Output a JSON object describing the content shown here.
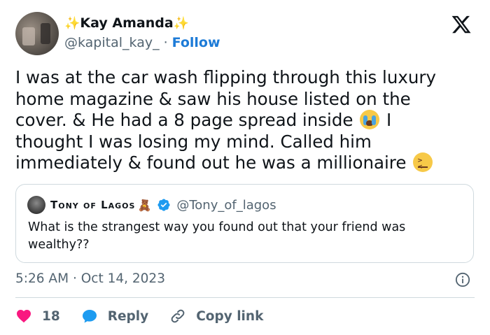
{
  "author": {
    "name": "Kay Amanda",
    "handle": "@kapital_kay_",
    "separator": "·",
    "follow_label": "Follow"
  },
  "tweet": {
    "text_part1": "I was at the car wash flipping through this luxury home magazine & saw his house listed on the cover. & He had a 8 page spread inside",
    "text_part2": "I thought I was losing my mind. Called him immediately & found out he was a millionaire",
    "emoji_1": "loudly-crying-face",
    "emoji_2": "confounded-face"
  },
  "quoted_tweet": {
    "name": "Tony of Lagos",
    "handle": "@Tony_of_lagos",
    "text": "What is the strangest way you found out that your friend was wealthy??"
  },
  "timestamp": {
    "time": "5:26 AM",
    "separator": "·",
    "date": "Oct 14, 2023"
  },
  "actions": {
    "like_count": "18",
    "reply_label": "Reply",
    "copy_label": "Copy link"
  },
  "colors": {
    "accent": "#1d7bd7",
    "like": "#f91880",
    "reply": "#1d9bf0",
    "muted": "#536471",
    "verified": "#1d9bf0"
  }
}
